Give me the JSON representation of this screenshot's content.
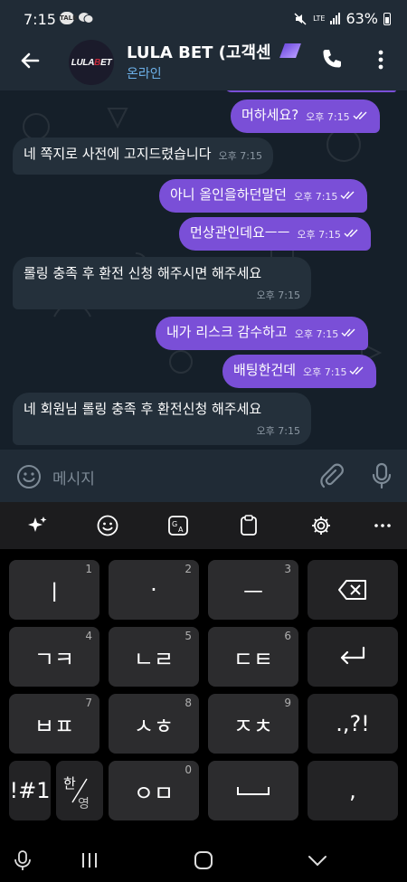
{
  "status_bar": {
    "time": "7:15",
    "notif_icons": [
      "TALK",
      "chat-bubbles-icon"
    ],
    "network": "LTE",
    "battery": "63%"
  },
  "header": {
    "back_icon": "arrow-left-icon",
    "avatar_logo": {
      "pre": "LULA",
      "mid": "B",
      "post": "ET"
    },
    "title": "LULA BET (고객센",
    "status": "온라인",
    "call_icon": "phone-icon",
    "more_icon": "more-vertical-icon"
  },
  "messages": [
    {
      "dir": "out",
      "text": "머하세요?",
      "time": "오후 7:15"
    },
    {
      "dir": "in",
      "text": "네 쪽지로 사전에 고지드렸습니다",
      "time": "오후 7:15"
    },
    {
      "dir": "out",
      "text": "아니 올인을하던말던",
      "time": "오후 7:15"
    },
    {
      "dir": "out",
      "text": "먼상관인데요ㅡㅡ",
      "time": "오후 7:15"
    },
    {
      "dir": "in",
      "text": "롤링 충족 후 환전 신청 해주시면 해주세요",
      "time": "오후 7:15"
    },
    {
      "dir": "out",
      "text": "내가 리스크 감수하고",
      "time": "오후 7:15"
    },
    {
      "dir": "out",
      "text": "배팅한건데",
      "time": "오후 7:15"
    },
    {
      "dir": "in",
      "text": "네 회원님 롤링 충족 후 환전신청 해주세요",
      "time": "오후 7:15"
    }
  ],
  "composer": {
    "placeholder": "메시지",
    "emoji_icon": "smiley-icon",
    "attach_icon": "paperclip-icon",
    "mic_icon": "microphone-icon"
  },
  "keyboard_toolbar": [
    "sparkle-ai-icon",
    "emoji-icon",
    "translate-icon",
    "clipboard-icon",
    "settings-gear-icon",
    "more-horizontal-icon"
  ],
  "keyboard": {
    "rows": [
      [
        {
          "label": "ㅣ",
          "hint": "1"
        },
        {
          "label": "·",
          "hint": "2"
        },
        {
          "label": "ㅡ",
          "hint": "3"
        },
        {
          "label": "",
          "icon": "backspace-icon"
        }
      ],
      [
        {
          "label": "ㄱㅋ",
          "hint": "4"
        },
        {
          "label": "ㄴㄹ",
          "hint": "5"
        },
        {
          "label": "ㄷㅌ",
          "hint": "6"
        },
        {
          "label": "",
          "icon": "enter-icon"
        }
      ],
      [
        {
          "label": "ㅂㅍ",
          "hint": "7"
        },
        {
          "label": "ㅅㅎ",
          "hint": "8"
        },
        {
          "label": "ㅈㅊ",
          "hint": "9"
        },
        {
          "label": ".,?!"
        }
      ],
      [
        {
          "label": "!#1"
        },
        {
          "label": "한/영"
        },
        {
          "label": "ㅇㅁ",
          "hint": "0"
        },
        {
          "label": "",
          "icon": "space-icon"
        },
        {
          "label": ","
        }
      ]
    ],
    "mode_key": {
      "top": "한",
      "bottom": "영"
    }
  },
  "navbar": [
    "mic-icon",
    "recents-icon",
    "home-icon",
    "back-chevron-icon"
  ]
}
